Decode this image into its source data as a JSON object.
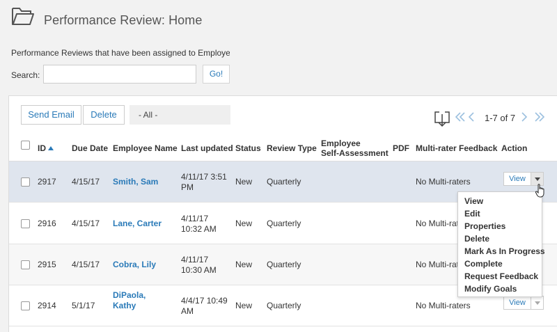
{
  "header": {
    "title": "Performance Review: Home",
    "icon": "folder-icon"
  },
  "description": "Performance Reviews that have been assigned to Employees",
  "search": {
    "label": "Search:",
    "value": "",
    "placeholder": "",
    "go_label": "Go!"
  },
  "toolbar": {
    "send_email_label": "Send Email",
    "delete_label": "Delete",
    "filter_value": "- All -"
  },
  "pager": {
    "text": "1-7 of 7"
  },
  "table": {
    "columns": {
      "id": "ID",
      "due_date": "Due Date",
      "employee_name": "Employee Name",
      "last_updated": "Last updated",
      "status": "Status",
      "review_type": "Review Type",
      "self_assessment_1": "Employee",
      "self_assessment_2": "Self-Assessment",
      "pdf": "PDF",
      "multi_rater": "Multi-rater Feedback",
      "action": "Action"
    },
    "rows": [
      {
        "id": "2917",
        "due_date": "4/15/17",
        "name_1": "Smith, Sam",
        "name_2": "",
        "updated_1": "4/11/17 3:51",
        "updated_2": "PM",
        "status": "New",
        "review_type": "Quarterly",
        "multi_rater": "No Multi-raters",
        "action_label": "View"
      },
      {
        "id": "2916",
        "due_date": "4/15/17",
        "name_1": "Lane, Carter",
        "name_2": "",
        "updated_1": "4/11/17",
        "updated_2": "10:32 AM",
        "status": "New",
        "review_type": "Quarterly",
        "multi_rater": "No Multi-raters",
        "action_label": "View"
      },
      {
        "id": "2915",
        "due_date": "4/15/17",
        "name_1": "Cobra, Lily",
        "name_2": "",
        "updated_1": "4/11/17",
        "updated_2": "10:30 AM",
        "status": "New",
        "review_type": "Quarterly",
        "multi_rater": "No Multi-raters",
        "action_label": "View"
      },
      {
        "id": "2914",
        "due_date": "5/1/17",
        "name_1": "DiPaola,",
        "name_2": "Kathy",
        "updated_1": "4/4/17 10:49",
        "updated_2": "AM",
        "status": "New",
        "review_type": "Quarterly",
        "multi_rater": "No Multi-raters",
        "action_label": "View"
      }
    ]
  },
  "action_menu": {
    "items": [
      "View",
      "Edit",
      "Properties",
      "Delete",
      "Mark As In Progress",
      "Complete",
      "Request Feedback",
      "Modify Goals"
    ]
  },
  "colors": {
    "link": "#2a7ab8",
    "selected_row": "#dfe5ee",
    "background": "#f2f2f2"
  }
}
